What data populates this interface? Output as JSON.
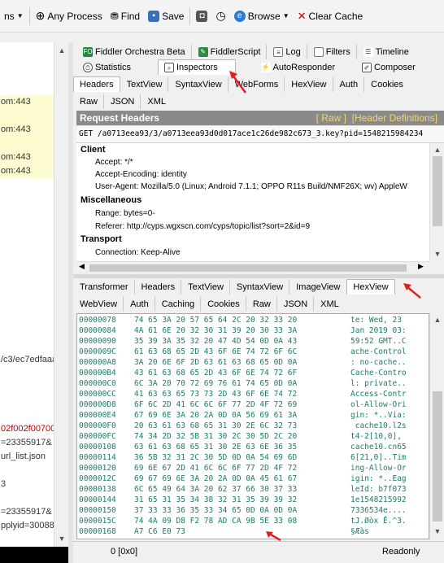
{
  "toolbar": {
    "items": [
      {
        "label": "ns",
        "icon": "caret-icon"
      },
      {
        "label": "Any Process",
        "icon": "crosshair-icon"
      },
      {
        "label": "Find",
        "icon": "binoculars-icon"
      },
      {
        "label": "Save",
        "icon": "save-icon"
      },
      {
        "label": "",
        "icon": "camera-icon"
      },
      {
        "label": "",
        "icon": "timer-icon"
      },
      {
        "label": "Browse",
        "icon": "ie-icon"
      },
      {
        "label": "Clear Cache",
        "icon": "clear-cache-icon"
      }
    ]
  },
  "session_list": {
    "rows": [
      {
        "text": "om:443",
        "style": "y"
      },
      {
        "text": "om:443",
        "style": "y"
      },
      {
        "text": "om:443",
        "style": "y"
      },
      {
        "text": "om:443",
        "style": "y"
      },
      {
        "text": "/c3/ec7edfaaa",
        "style": ""
      },
      {
        "text": "02f002f00700",
        "style": "red"
      },
      {
        "text": "=23355917&",
        "style": ""
      },
      {
        "text": "url_list.json",
        "style": ""
      },
      {
        "text": "3",
        "style": ""
      },
      {
        "text": "=23355917&",
        "style": ""
      },
      {
        "text": "pplyid=30088",
        "style": ""
      }
    ]
  },
  "top_tabs_row1": [
    "Fiddler Orchestra Beta",
    "FiddlerScript",
    "Log",
    "Filters",
    "Timeline"
  ],
  "top_tabs_row2": [
    "Statistics",
    "Inspectors",
    "AutoResponder",
    "Composer"
  ],
  "request_tabs_row1": [
    "Headers",
    "TextView",
    "SyntaxView",
    "WebForms",
    "HexView",
    "Auth",
    "Cookies"
  ],
  "request_tabs_row2": [
    "Raw",
    "JSON",
    "XML"
  ],
  "request_headers": {
    "title": "Request Headers",
    "raw_link": "[ Raw ]",
    "defs_link": "[Header Definitions]",
    "url": "GET /a0713eea93/3/a0713eea93d0d017ace1c26de982c673_3.key?pid=1548215984234",
    "groups": [
      {
        "name": "Client",
        "items": [
          "Accept: */*",
          "Accept-Encoding: identity",
          "User-Agent: Mozilla/5.0 (Linux; Android 7.1.1; OPPO R11s Build/NMF26X; wv) AppleW"
        ]
      },
      {
        "name": "Miscellaneous",
        "items": [
          "Range: bytes=0-",
          "Referer: http://cyps.wgxscn.com/cyps/topic/list?sort=2&id=9"
        ]
      },
      {
        "name": "Transport",
        "items": [
          "Connection: Keep-Alive"
        ]
      }
    ]
  },
  "response_tabs_row1": [
    "Transformer",
    "Headers",
    "TextView",
    "SyntaxView",
    "ImageView",
    "HexView"
  ],
  "response_tabs_row2": [
    "WebView",
    "Auth",
    "Caching",
    "Cookies",
    "Raw",
    "JSON",
    "XML"
  ],
  "hexview": {
    "rows": [
      {
        "off": "00000078",
        "hex": "74 65 3A 20 57 65 64 2C 20 32 33 20",
        "asc": "te: Wed, 23"
      },
      {
        "off": "00000084",
        "hex": "4A 61 6E 20 32 30 31 39 20 30 33 3A",
        "asc": "Jan 2019 03:"
      },
      {
        "off": "00000090",
        "hex": "35 39 3A 35 32 20 47 4D 54 0D 0A 43",
        "asc": "59:52 GMT..C"
      },
      {
        "off": "0000009C",
        "hex": "61 63 68 65 2D 43 6F 6E 74 72 6F 6C",
        "asc": "ache-Control"
      },
      {
        "off": "000000A8",
        "hex": "3A 20 6E 6F 2D 63 61 63 68 65 0D 0A",
        "asc": ": no-cache.."
      },
      {
        "off": "000000B4",
        "hex": "43 61 63 68 65 2D 43 6F 6E 74 72 6F",
        "asc": "Cache-Contro"
      },
      {
        "off": "000000C0",
        "hex": "6C 3A 20 70 72 69 76 61 74 65 0D 0A",
        "asc": "l: private.."
      },
      {
        "off": "000000CC",
        "hex": "41 63 63 65 73 73 2D 43 6F 6E 74 72",
        "asc": "Access-Contr"
      },
      {
        "off": "000000D8",
        "hex": "6F 6C 2D 41 6C 6C 6F 77 2D 4F 72 69",
        "asc": "ol-Allow-Ori"
      },
      {
        "off": "000000E4",
        "hex": "67 69 6E 3A 20 2A 0D 0A 56 69 61 3A",
        "asc": "gin: *..Via:"
      },
      {
        "off": "000000F0",
        "hex": "20 63 61 63 68 65 31 30 2E 6C 32 73",
        "asc": " cache10.l2s"
      },
      {
        "off": "000000FC",
        "hex": "74 34 2D 32 5B 31 30 2C 30 5D 2C 20",
        "asc": "t4-2[10,0], "
      },
      {
        "off": "00000108",
        "hex": "63 61 63 68 65 31 30 2E 63 6E 36 35",
        "asc": "cache10.cn65"
      },
      {
        "off": "00000114",
        "hex": "36 5B 32 31 2C 30 5D 0D 0A 54 69 6D",
        "asc": "6[21,0]..Tim"
      },
      {
        "off": "00000120",
        "hex": "69 6E 67 2D 41 6C 6C 6F 77 2D 4F 72",
        "asc": "ing-Allow-Or"
      },
      {
        "off": "0000012C",
        "hex": "69 67 69 6E 3A 20 2A 0D 0A 45 61 67",
        "asc": "igin: *..Eag"
      },
      {
        "off": "00000138",
        "hex": "6C 65 49 64 3A 20 62 37 66 30 37 33",
        "asc": "leId: b7f073"
      },
      {
        "off": "00000144",
        "hex": "31 65 31 35 34 38 32 31 35 39 39 32",
        "asc": "1e1548215992"
      },
      {
        "off": "00000150",
        "hex": "37 33 33 36 35 33 34 65 0D 0A 0D 0A",
        "asc": "7336534e...."
      },
      {
        "off": "0000015C",
        "hex": "74 4A 09 D8 F2 78 AD CA 9B 5E 33 08",
        "asc": "tJ.Øòx Ê.^3."
      },
      {
        "off": "00000168",
        "hex": "A7 C6 E0 73",
        "asc": "§Æàs"
      }
    ]
  },
  "status": {
    "position": "0 [0x0]",
    "state": "Readonly"
  },
  "colors": {
    "accent_orange": "#f5d56b",
    "hex_text": "#1f7a6a",
    "arrow_red": "#e02020"
  }
}
